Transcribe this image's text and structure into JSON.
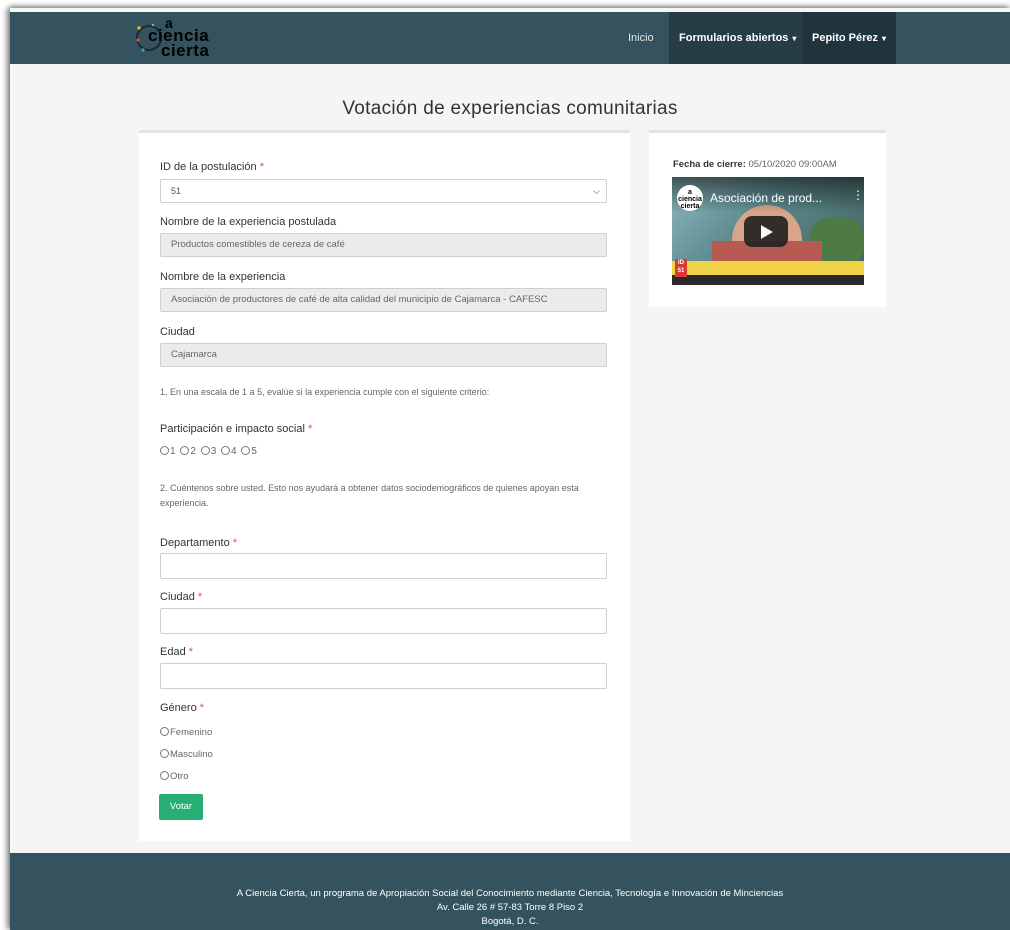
{
  "brand": {
    "line1": "a",
    "line2": "ciencia",
    "line3": "cierta"
  },
  "nav": {
    "inicio": "Inicio",
    "forms": "Formularios abiertos",
    "user": "Pepito Pérez",
    "caret": "▾"
  },
  "page": {
    "title": "Votación de experiencias comunitarias"
  },
  "form": {
    "id_label": "ID de la postulación",
    "id_value": "51",
    "exp_post_label": "Nombre de la experiencia postulada",
    "exp_post_value": "Productos comestibles de cereza de café",
    "exp_label": "Nombre de la experiencia",
    "exp_value": "Asociación de productores de café de alta calidad del municipio de Cajamarca - CAFESC",
    "city_label": "Ciudad",
    "city_value": "Cajamarca",
    "note1": "1. En una escala de 1 a 5, evalúe si la experiencia cumple con el siguiente criterio:",
    "criterion_label": "Participación e impacto social",
    "scale": [
      "1",
      "2",
      "3",
      "4",
      "5"
    ],
    "note2": "2. Cuéntenos sobre usted. Esto nos ayudará a obtener datos sociodemográficos de quienes apoyan esta experiencia.",
    "dept_label": "Departamento",
    "city2_label": "Ciudad",
    "age_label": "Edad",
    "gender_label": "Género",
    "genders": [
      "Femenino",
      "Masculino",
      "Otro"
    ],
    "required_mark": "*",
    "submit": "Votar"
  },
  "side": {
    "closing_label": "Fecha de cierre:",
    "closing_value": "05/10/2020 09:00AM",
    "video_title": "Asociación de prod...",
    "video_menu": "⋮",
    "video_channel": "a\nciencia\ncierta",
    "video_id_tag": "ID 51"
  },
  "footer": {
    "line1": "A Ciencia Cierta, un programa de Apropiación Social del Conocimiento mediante Ciencia, Tecnología e Innovación de Minciencias",
    "line2": "Av. Calle 26 # 57-83 Torre 8 Piso 2",
    "line3": "Bogotá, D. C."
  },
  "colors": {
    "navbar": "#34535f",
    "accent": "#27ae77",
    "required": "#d9534f"
  }
}
